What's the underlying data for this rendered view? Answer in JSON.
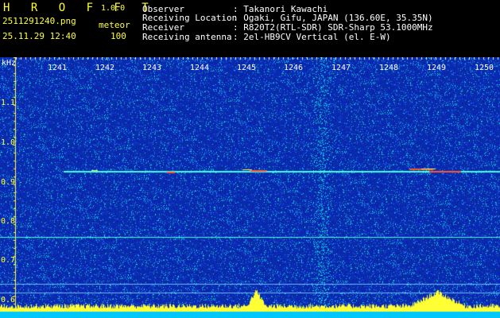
{
  "app": {
    "logo": "H R O F F T",
    "version": "1.0.0"
  },
  "file": {
    "name": "2511291240.png",
    "datetime": "25.11.29 12:40"
  },
  "mode": {
    "label": "meteor",
    "value": "100"
  },
  "info": [
    {
      "key": "Observer",
      "value": ": Takanori Kawachi"
    },
    {
      "key": "Receiving Location",
      "value": ": Ogaki, Gifu, JAPAN (136.60E, 35.35N)"
    },
    {
      "key": "Receiver",
      "value": ": R820T2(RTL-SDR) SDR-Sharp 53.1000MHz"
    },
    {
      "key": "Receiving antenna",
      "value": ": 2el-HB9CV Vertical (el. E-W)"
    }
  ],
  "axis": {
    "y_unit": "kHz",
    "y_labels": [
      "1.1",
      "1.0",
      "0.9",
      "0.8",
      "0.7",
      "0.6"
    ],
    "x_labels": [
      "1241",
      "1242",
      "1243",
      "1244",
      "1245",
      "1246",
      "1247",
      "1248",
      "1249",
      "1250"
    ]
  },
  "colors": {
    "background": "#0a1c9e",
    "signal": "#33ffdd",
    "activity": "#ffff33",
    "baseline": "#00c8ff"
  }
}
